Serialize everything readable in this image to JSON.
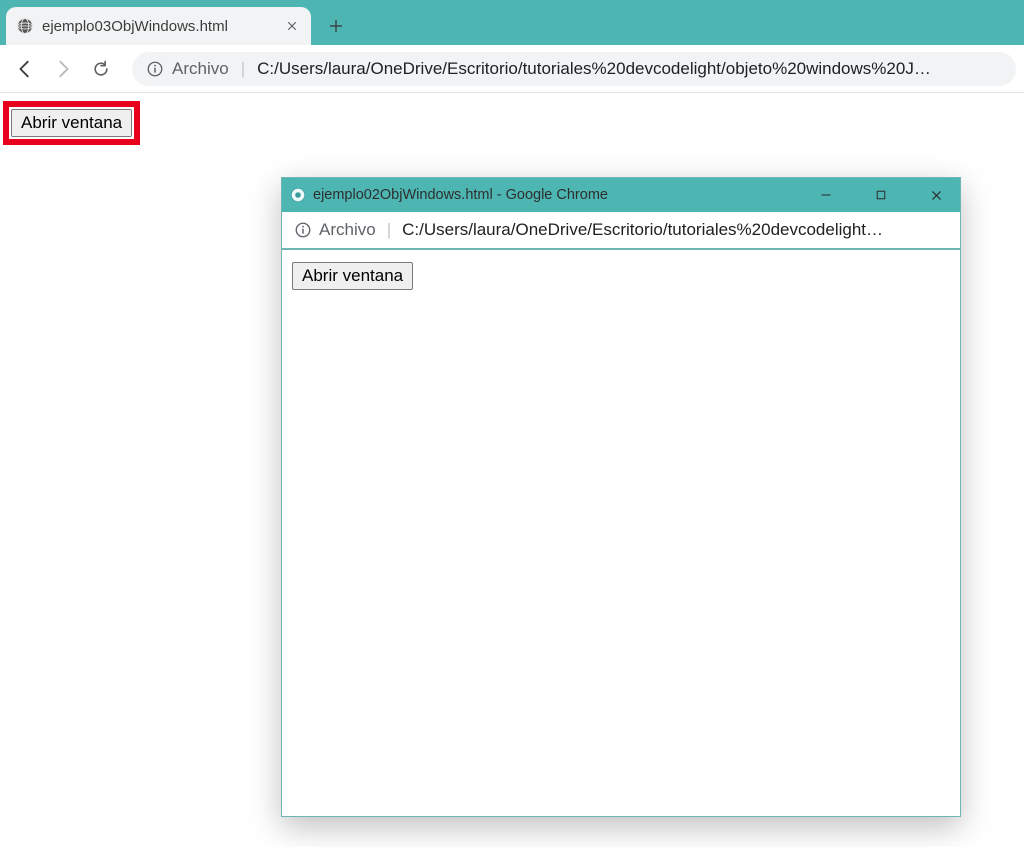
{
  "main_browser": {
    "tab": {
      "title": "ejemplo03ObjWindows.html",
      "close_glyph": "✕"
    },
    "new_tab_glyph": "+",
    "toolbar": {
      "scheme_label": "Archivo",
      "url_display": "C:/Users/laura/OneDrive/Escritorio/tutoriales%20devcodelight/objeto%20windows%20J…"
    },
    "page": {
      "open_button": "Abrir ventana"
    }
  },
  "popup": {
    "title": "ejemplo02ObjWindows.html - Google Chrome",
    "urlbar": {
      "scheme_label": "Archivo",
      "url_display": "C:/Users/laura/OneDrive/Escritorio/tutoriales%20devcodelight…"
    },
    "page": {
      "open_button": "Abrir ventana"
    }
  }
}
